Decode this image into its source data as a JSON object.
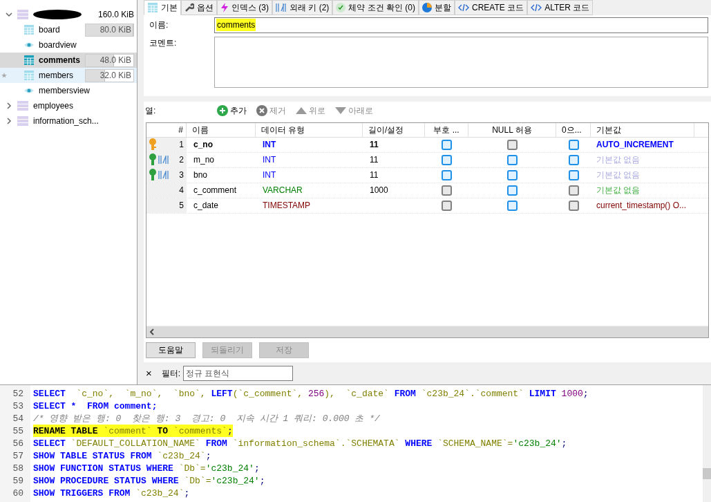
{
  "tree": {
    "database": {
      "size": "160.0 KiB",
      "expanded": true,
      "items": [
        {
          "kind": "table",
          "name": "board",
          "size": "80.0 KiB",
          "level": 1,
          "selected": false,
          "highlighted": false
        },
        {
          "kind": "view",
          "name": "boardview",
          "selected": false,
          "highlighted": false
        },
        {
          "kind": "table",
          "name": "comments",
          "size": "48.0 KiB",
          "level": 0.6,
          "selected": true,
          "highlighted": false
        },
        {
          "kind": "table",
          "name": "members",
          "size": "32.0 KiB",
          "level": 0.4,
          "selected": false,
          "highlighted": true
        },
        {
          "kind": "view",
          "name": "membersview",
          "selected": false,
          "highlighted": false
        }
      ]
    },
    "others": [
      {
        "name": "employees",
        "expanded": false
      },
      {
        "name": "information_sch...",
        "expanded": false
      }
    ]
  },
  "tabs": [
    {
      "kind": "table",
      "label": "기본",
      "selected": true
    },
    {
      "kind": "options",
      "label": "옵션",
      "selected": false
    },
    {
      "kind": "indexes",
      "label": "인덱스 (3)",
      "selected": false
    },
    {
      "kind": "foreign",
      "label": "외래 키 (2)",
      "selected": false
    },
    {
      "kind": "checks",
      "label": "체약 조건 확인 (0)",
      "selected": false
    },
    {
      "kind": "partitions",
      "label": "분할",
      "selected": false
    },
    {
      "kind": "code",
      "label": "CREATE 코드",
      "selected": false
    },
    {
      "kind": "code",
      "label": "ALTER 코드",
      "selected": false
    }
  ],
  "name_field": {
    "label": "이름:",
    "value": "comments"
  },
  "comment_field": {
    "label": "코멘트:"
  },
  "columns_toolbar": {
    "label": "열:",
    "actions": [
      {
        "kind": "add",
        "label": "추가",
        "disabled": false
      },
      {
        "kind": "remove",
        "label": "제거",
        "disabled": true
      },
      {
        "kind": "up",
        "label": "위로",
        "disabled": true
      },
      {
        "kind": "down",
        "label": "아래로",
        "disabled": true
      }
    ]
  },
  "table": {
    "headers": [
      "#",
      "이름",
      "데이터 유형",
      "길이/설정",
      "부호 ...",
      "NULL 허용",
      "0으...",
      "기본값"
    ],
    "rows": [
      {
        "kind": "primary",
        "num": "1",
        "name": "c_no",
        "type": {
          "kind": "integer",
          "text": "INT"
        },
        "length": "11",
        "bold": true,
        "unsigned_disabled": false,
        "null_disabled": true,
        "zerofill_disabled": false,
        "default": {
          "kind": "auto",
          "text": "AUTO_INCREMENT"
        }
      },
      {
        "kind": "foreign",
        "num": "2",
        "name": "m_no",
        "type": {
          "kind": "integer",
          "text": "INT"
        },
        "length": "11",
        "bold": false,
        "unsigned_disabled": false,
        "null_disabled": false,
        "zerofill_disabled": false,
        "default": {
          "kind": "none_integer",
          "text": "기본값 없음"
        }
      },
      {
        "kind": "foreign",
        "num": "3",
        "name": "bno",
        "type": {
          "kind": "integer",
          "text": "INT"
        },
        "length": "11",
        "bold": false,
        "unsigned_disabled": false,
        "null_disabled": false,
        "zerofill_disabled": false,
        "default": {
          "kind": "none_integer",
          "text": "기본값 없음"
        }
      },
      {
        "kind": "plain",
        "num": "4",
        "name": "c_comment",
        "type": {
          "kind": "text",
          "text": "VARCHAR"
        },
        "length": "1000",
        "bold": false,
        "unsigned_disabled": true,
        "null_disabled": false,
        "zerofill_disabled": true,
        "default": {
          "kind": "none_text",
          "text": "기본값 없음"
        }
      },
      {
        "kind": "plain",
        "num": "5",
        "name": "c_date",
        "type": {
          "kind": "date",
          "text": "TIMESTAMP"
        },
        "bold": false,
        "unsigned_disabled": true,
        "null_disabled": false,
        "zerofill_disabled": true,
        "default": {
          "kind": "expression",
          "text": "current_timestamp() O..."
        }
      }
    ]
  },
  "buttons": [
    {
      "label": "도움말",
      "disabled": false
    },
    {
      "label": "되돌리기",
      "disabled": true
    },
    {
      "label": "저장",
      "disabled": true
    }
  ],
  "filter": {
    "close": "×",
    "label": "필터:",
    "placeholder": "정규 표현식"
  },
  "sql": [
    {
      "num": "52",
      "highlighted": false,
      "tokens": [
        {
          "kind": "kw",
          "text": "SELECT"
        },
        {
          "kind": "id",
          "text": "  `c_no`,  `m_no`,  `bno`, "
        },
        {
          "kind": "kw",
          "text": "LEFT"
        },
        {
          "kind": "id",
          "text": "(`c_comment`, "
        },
        {
          "kind": "num",
          "text": "256"
        },
        {
          "kind": "id",
          "text": "),  `c_date` "
        },
        {
          "kind": "kw",
          "text": "FROM"
        },
        {
          "kind": "id",
          "text": " `c23b_24`.`comment` "
        },
        {
          "kind": "kw",
          "text": "LIMIT"
        },
        {
          "kind": "num",
          "text": " 1000"
        },
        {
          "kind": "p",
          "text": ";"
        }
      ]
    },
    {
      "num": "53",
      "highlighted": false,
      "tokens": [
        {
          "kind": "kw",
          "text": "SELECT *  FROM comment;"
        }
      ]
    },
    {
      "num": "54",
      "highlighted": false,
      "tokens": [
        {
          "kind": "cm",
          "text": "/* 영향 받은 행: 0  찾은 행: 3  경고: 0  지속 시간 1 쿼리: 0.000 초 */"
        }
      ]
    },
    {
      "num": "55",
      "highlighted": true,
      "tokens": [
        {
          "kind": "kw",
          "text": "RENAME TABLE"
        },
        {
          "kind": "id",
          "text": " `comment` "
        },
        {
          "kind": "kw",
          "text": "TO"
        },
        {
          "kind": "id",
          "text": " `comments`"
        },
        {
          "kind": "p",
          "text": ";"
        }
      ]
    },
    {
      "num": "56",
      "highlighted": false,
      "tokens": [
        {
          "kind": "kw",
          "text": "SELECT"
        },
        {
          "kind": "id",
          "text": " `DEFAULT_COLLATION_NAME` "
        },
        {
          "kind": "kw",
          "text": "FROM"
        },
        {
          "kind": "id",
          "text": " `information_schema`.`SCHEMATA` "
        },
        {
          "kind": "kw",
          "text": "WHERE"
        },
        {
          "kind": "id",
          "text": " `SCHEMA_NAME`="
        },
        {
          "kind": "str",
          "text": "'c23b_24'"
        },
        {
          "kind": "p",
          "text": ";"
        }
      ]
    },
    {
      "num": "57",
      "highlighted": false,
      "tokens": [
        {
          "kind": "kw",
          "text": "SHOW TABLE STATUS FROM"
        },
        {
          "kind": "id",
          "text": " `c23b_24`"
        },
        {
          "kind": "p",
          "text": ";"
        }
      ]
    },
    {
      "num": "58",
      "highlighted": false,
      "tokens": [
        {
          "kind": "kw",
          "text": "SHOW FUNCTION STATUS WHERE"
        },
        {
          "kind": "id",
          "text": " `Db`="
        },
        {
          "kind": "str",
          "text": "'c23b_24'"
        },
        {
          "kind": "p",
          "text": ";"
        }
      ]
    },
    {
      "num": "59",
      "highlighted": false,
      "tokens": [
        {
          "kind": "kw",
          "text": "SHOW PROCEDURE STATUS WHERE"
        },
        {
          "kind": "id",
          "text": " `Db`="
        },
        {
          "kind": "str",
          "text": "'c23b_24'"
        },
        {
          "kind": "p",
          "text": ";"
        }
      ]
    },
    {
      "num": "60",
      "highlighted": false,
      "tokens": [
        {
          "kind": "kw",
          "text": "SHOW TRIGGERS FROM"
        },
        {
          "kind": "id",
          "text": " `c23b_24`"
        },
        {
          "kind": "p",
          "text": ";"
        }
      ]
    }
  ]
}
